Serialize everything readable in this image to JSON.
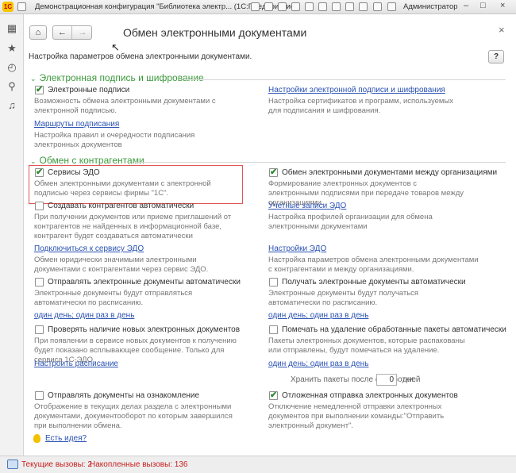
{
  "window": {
    "title": "Демонстрационная конфигурация \"Библиотека электр... (1С:Предприятие)",
    "user": "Администратор"
  },
  "header": {
    "title": "Обмен электронными документами",
    "subtitle": "Настройка параметров обмена электронными документами.",
    "help_label": "?",
    "home_glyph": "⌂",
    "back_glyph": "←",
    "forward_glyph": "→",
    "close_glyph": "×"
  },
  "section1": {
    "title": "Электронная подпись и шифрование",
    "esign_checkbox": {
      "label": "Электронные подписи",
      "checked": true
    },
    "esign_desc": "Возможность обмена электронными документами с электронной подписью.",
    "routes_link": "Маршруты подписания",
    "routes_desc": "Настройка правил и очередности подписания электронных документов",
    "settings_link": "Настройки электронной подписи и шифрования",
    "settings_desc": "Настройка сертификатов и программ, используемых для подписания и шифрования."
  },
  "section2": {
    "title": "Обмен с контрагентами",
    "edo_services": {
      "label": "Сервисы ЭДО",
      "checked": true
    },
    "edo_services_desc": "Обмен электронными документами с электронной подписью через сервисы фирмы \"1С\".",
    "create_contractors": {
      "label": "Создавать контрагентов автоматически",
      "checked": false
    },
    "create_contractors_desc": "При получении документов или приеме приглашений от контрагентов не найденных в информационной базе, контрагент будет создаваться автоматически",
    "connect_link": "Подключиться к сервису ЭДО",
    "connect_desc": "Обмен юридически значимыми электронными документами с контрагентами через сервис ЭДО.",
    "send_auto": {
      "label": "Отправлять электронные документы автоматически",
      "checked": false
    },
    "send_auto_desc": "Электронные документы будут отправляться автоматически по расписанию.",
    "send_schedule_link": "один день; один раз в день",
    "check_new": {
      "label": "Проверять наличие новых электронных документов",
      "checked": false
    },
    "check_new_desc": "При появлении в сервисе новых документов к получению будет показано всплывающее сообщение. Только для сервиса 1С-ЭДО.",
    "configure_schedule_link": "Настроить расписание",
    "review": {
      "label": "Отправлять документы на ознакомление",
      "checked": false
    },
    "review_desc": "Отображение в текущих делах раздела с электронными документами, документооборот по которым завершился при выполнении обмена.",
    "inter_org": {
      "label": "Обмен электронными документами между организациями",
      "checked": true
    },
    "inter_org_desc": "Формирование электронных документов с электронными подписями при передаче товаров между организациями.",
    "accounts_link": "Учетные записи ЭДО",
    "accounts_desc": "Настройка профилей организации для обмена электронными документами",
    "edo_settings_link": "Настройки ЭДО",
    "edo_settings_desc": "Настройка параметров обмена электронными документами с контрагентами и между организациями.",
    "receive_auto": {
      "label": "Получать электронные документы автоматически",
      "checked": false
    },
    "receive_auto_desc": "Электронные документы будут получаться автоматически по расписанию.",
    "receive_schedule_link": "один день; один раз в день",
    "mark_delete": {
      "label": "Помечать на удаление обработанные пакеты автоматически",
      "checked": false
    },
    "mark_delete_desc": "Пакеты электронных документов, которые распакованы или отправлены, будут помечаться на удаление.",
    "mark_schedule_link": "один день; один раз в день",
    "keep_label": "Хранить пакеты после обработки:",
    "keep_value": "0",
    "keep_unit": "дней",
    "delayed": {
      "label": "Отложенная отправка электронных документов",
      "checked": true
    },
    "delayed_desc": "Отключение немедленной отправки электронных документов при выполнении команды:\"Отправить электронный документ\"."
  },
  "ideas_link": "Есть идея?",
  "status": {
    "current_calls": "Текущие вызовы: 2",
    "accumulated_calls": "Накопленные вызовы: 136"
  },
  "colors": {
    "section_green": "#3d9a3d",
    "link_blue": "#2a52b3",
    "status_red": "#c8201f",
    "highlight_red": "#e05555"
  }
}
